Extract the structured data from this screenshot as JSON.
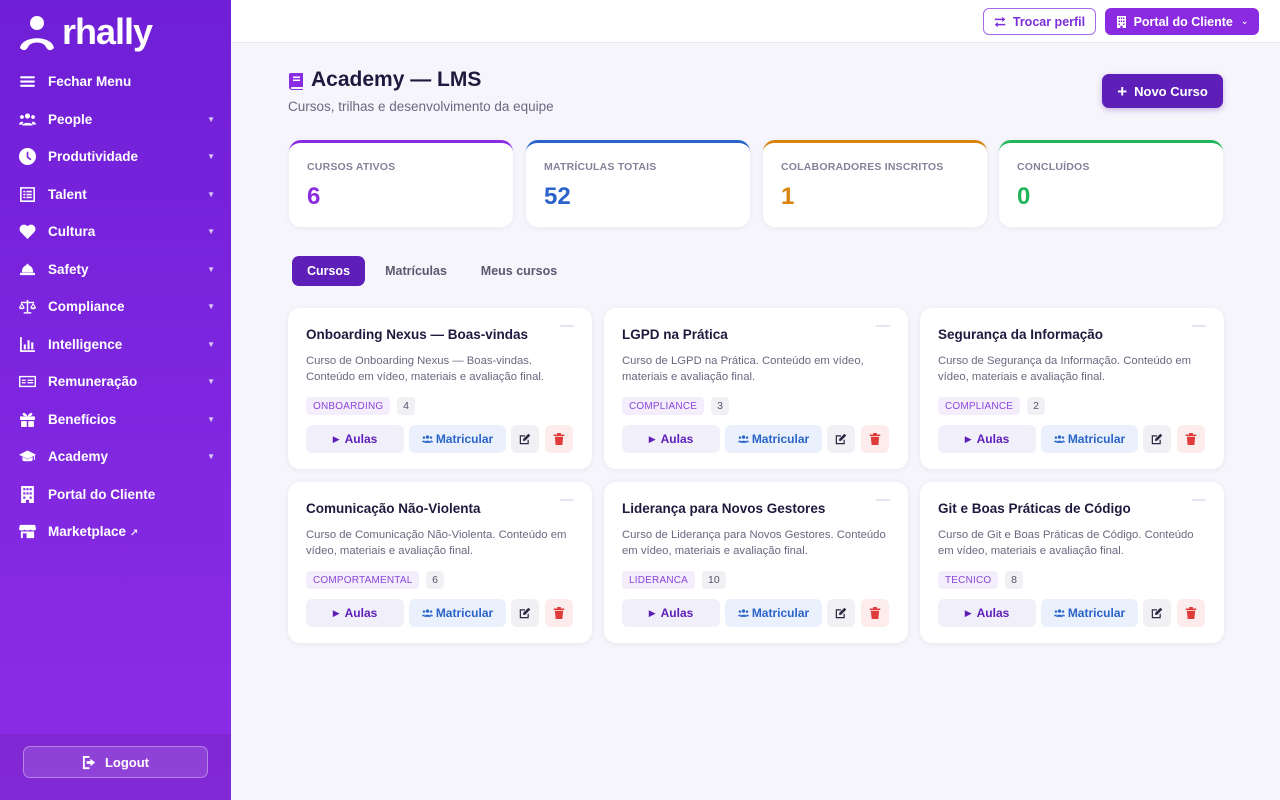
{
  "brand": {
    "name": "rhally"
  },
  "sidebar": {
    "items": [
      {
        "label": "Fechar Menu",
        "icon": "menu-icon",
        "chevron": false
      },
      {
        "label": "People",
        "icon": "users-icon",
        "chevron": true
      },
      {
        "label": "Produtividade",
        "icon": "clock-icon",
        "chevron": true
      },
      {
        "label": "Talent",
        "icon": "list-icon",
        "chevron": true
      },
      {
        "label": "Cultura",
        "icon": "heart-icon",
        "chevron": true
      },
      {
        "label": "Safety",
        "icon": "hardhat-icon",
        "chevron": true
      },
      {
        "label": "Compliance",
        "icon": "scale-icon",
        "chevron": true
      },
      {
        "label": "Intelligence",
        "icon": "chart-icon",
        "chevron": true
      },
      {
        "label": "Remuneração",
        "icon": "money-icon",
        "chevron": true
      },
      {
        "label": "Benefícios",
        "icon": "gift-icon",
        "chevron": true
      },
      {
        "label": "Academy",
        "icon": "graduation-cap-icon",
        "chevron": true
      },
      {
        "label": "Portal do Cliente",
        "icon": "building-icon",
        "chevron": false
      },
      {
        "label": "Marketplace",
        "icon": "store-icon",
        "chevron": false,
        "external": true
      }
    ],
    "chevron_glyph": "▼",
    "external_glyph": "↗",
    "logout_label": "Logout"
  },
  "topbar": {
    "switch_profile_label": "Trocar perfil",
    "portal_label": "Portal do Cliente",
    "portal_caret": "⌄"
  },
  "page": {
    "title": "Academy — LMS",
    "subtitle": "Cursos, trilhas e desenvolvimento da equipe",
    "new_course_plus": "+",
    "new_course_label": "Novo Curso"
  },
  "stats": [
    {
      "label": "CURSOS ATIVOS",
      "value": "6",
      "color": "#8a2be2"
    },
    {
      "label": "MATRÍCULAS TOTAIS",
      "value": "52",
      "color": "#2b64c9"
    },
    {
      "label": "COLABORADORES INSCRITOS",
      "value": "1",
      "color": "#d9830f"
    },
    {
      "label": "CONCLUÍDOS",
      "value": "0",
      "color": "#22b55a"
    }
  ],
  "tabs": [
    {
      "label": "Cursos",
      "active": true
    },
    {
      "label": "Matrículas",
      "active": false
    },
    {
      "label": "Meus cursos",
      "active": false
    }
  ],
  "card_actions": {
    "aulas_label": "Aulas",
    "matricular_label": "Matricular",
    "play_glyph": "▶"
  },
  "courses": [
    {
      "title": "Onboarding Nexus — Boas-vindas",
      "description": "Curso de Onboarding Nexus — Boas-vindas. Conteúdo em vídeo, materiais e avaliação final.",
      "tag": "ONBOARDING",
      "count": "4"
    },
    {
      "title": "LGPD na Prática",
      "description": "Curso de LGPD na Prática. Conteúdo em vídeo, materiais e avaliação final.",
      "tag": "COMPLIANCE",
      "count": "3"
    },
    {
      "title": "Segurança da Informação",
      "description": "Curso de Segurança da Informação. Conteúdo em vídeo, materiais e avaliação final.",
      "tag": "COMPLIANCE",
      "count": "2"
    },
    {
      "title": "Comunicação Não-Violenta",
      "description": "Curso de Comunicação Não-Violenta. Conteúdo em vídeo, materiais e avaliação final.",
      "tag": "COMPORTAMENTAL",
      "count": "6"
    },
    {
      "title": "Liderança para Novos Gestores",
      "description": "Curso de Liderança para Novos Gestores. Conteúdo em vídeo, materiais e avaliação final.",
      "tag": "LIDERANCA",
      "count": "10"
    },
    {
      "title": "Git e Boas Práticas de Código",
      "description": "Curso de Git e Boas Práticas de Código. Conteúdo em vídeo, materiais e avaliação final.",
      "tag": "TECNICO",
      "count": "8"
    }
  ]
}
